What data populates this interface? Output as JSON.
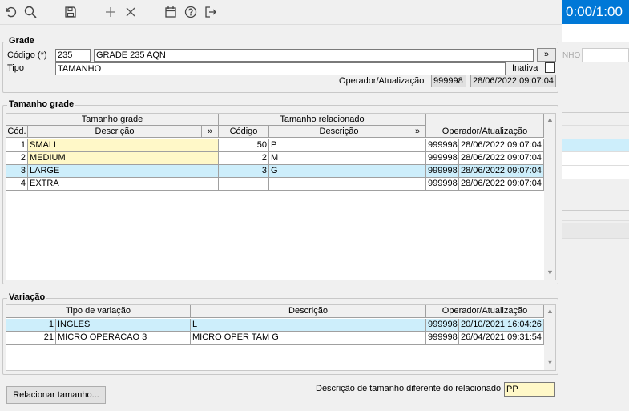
{
  "background_app": {
    "timer": "0:00/1:00",
    "partial_label": "NHO"
  },
  "toolbar": {
    "icons": [
      "undo-icon",
      "search-icon",
      "save-icon",
      "add-icon",
      "close-icon",
      "calendar-icon",
      "help-icon",
      "exit-icon"
    ]
  },
  "grade": {
    "title": "Grade",
    "codigo_label": "Código (*)",
    "codigo_value": "235",
    "codigo_desc": "GRADE 235 AQN",
    "more_button": "»",
    "tipo_label": "Tipo",
    "tipo_value": "TAMANHO",
    "inativa_label": "Inativa",
    "operador_label": "Operador/Atualização",
    "operador_value": "999998",
    "atualizacao_value": "28/06/2022 09:07:04"
  },
  "tamanho_grade": {
    "title": "Tamanho grade",
    "group_header_left": "Tamanho grade",
    "group_header_right": "Tamanho relacionado",
    "columns": {
      "cod": "Cód.",
      "descricao": "Descrição",
      "more": "»",
      "codigo": "Código",
      "descricao_rel": "Descrição",
      "more_rel": "»",
      "operador": "Operador/Atualização"
    },
    "rows": [
      {
        "cod": "1",
        "descricao": "SMALL",
        "codigo": "50",
        "descricao_rel": "P",
        "operador": "999998",
        "data": "28/06/2022 09:07:04"
      },
      {
        "cod": "2",
        "descricao": "MEDIUM",
        "codigo": "2",
        "descricao_rel": "M",
        "operador": "999998",
        "data": "28/06/2022 09:07:04"
      },
      {
        "cod": "3",
        "descricao": "LARGE",
        "codigo": "3",
        "descricao_rel": "G",
        "operador": "999998",
        "data": "28/06/2022 09:07:04"
      },
      {
        "cod": "4",
        "descricao": "EXTRA",
        "codigo": "",
        "descricao_rel": "",
        "operador": "999998",
        "data": "28/06/2022 09:07:04"
      }
    ]
  },
  "variacao": {
    "title": "Variação",
    "columns": {
      "tipo": "Tipo de variação",
      "descricao": "Descrição",
      "operador": "Operador/Atualização"
    },
    "rows": [
      {
        "cod": "1",
        "tipo": "INGLES",
        "descricao": "L",
        "operador": "999998",
        "data": "20/10/2021 16:04:26"
      },
      {
        "cod": "21",
        "tipo": "MICRO OPERACAO 3",
        "descricao": "MICRO OPER TAM G",
        "operador": "999998",
        "data": "26/04/2021 09:31:54"
      }
    ]
  },
  "footer": {
    "relacionar_button": "Relacionar tamanho...",
    "desc_diff_label": "Descrição de tamanho diferente do relacionado",
    "desc_diff_value": "PP"
  },
  "colors": {
    "highlight_yellow": "#fff8c8",
    "selected_row": "#cdeefb",
    "accent_blue": "#0078d7"
  }
}
